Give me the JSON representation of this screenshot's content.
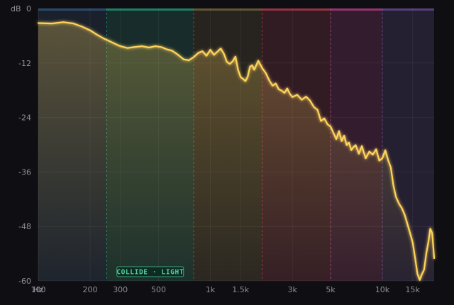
{
  "chart_data": {
    "type": "area",
    "xscale": "log",
    "xlim": [
      100,
      20000
    ],
    "ylim": [
      -60,
      0
    ],
    "ylabel": "dB",
    "grid": true,
    "y_ticks": [
      0,
      -12,
      -24,
      -36,
      -48,
      -60
    ],
    "x_ticks": [
      {
        "value": 100,
        "label": "100"
      },
      {
        "value": 100,
        "label": "Hz"
      },
      {
        "value": 200,
        "label": "200"
      },
      {
        "value": 300,
        "label": "300"
      },
      {
        "value": 500,
        "label": "500"
      },
      {
        "value": 1000,
        "label": "1k"
      },
      {
        "value": 1500,
        "label": "1.5k"
      },
      {
        "value": 3000,
        "label": "3k"
      },
      {
        "value": 5000,
        "label": "5k"
      },
      {
        "value": 10000,
        "label": "10k"
      },
      {
        "value": 15000,
        "label": "15k"
      }
    ],
    "bands": [
      {
        "from": 100,
        "to": 250,
        "color": "#2e5a86"
      },
      {
        "from": 250,
        "to": 800,
        "color": "#1fa37a"
      },
      {
        "from": 800,
        "to": 2000,
        "color": "#7a6a38"
      },
      {
        "from": 2000,
        "to": 5000,
        "color": "#c0374f"
      },
      {
        "from": 5000,
        "to": 10000,
        "color": "#c23a8a"
      },
      {
        "from": 10000,
        "to": 20000,
        "color": "#6a4aa0"
      }
    ],
    "line_color": "#ffd45c",
    "series": [
      {
        "x": [
          100,
          120,
          140,
          160,
          180,
          200,
          220,
          240,
          260,
          280,
          300,
          330,
          360,
          400,
          440,
          480,
          520,
          560,
          600,
          650,
          700,
          750,
          800,
          850,
          900,
          950,
          1000,
          1050,
          1100,
          1150,
          1200,
          1250,
          1300,
          1350,
          1400,
          1450,
          1500,
          1550,
          1600,
          1650,
          1700,
          1750,
          1800,
          1900,
          2000,
          2100,
          2200,
          2300,
          2400,
          2500,
          2600,
          2700,
          2800,
          2900,
          3000,
          3200,
          3400,
          3600,
          3800,
          4000,
          4200,
          4400,
          4600,
          4800,
          5000,
          5200,
          5400,
          5600,
          5800,
          6000,
          6200,
          6400,
          6600,
          6800,
          7000,
          7300,
          7600,
          8000,
          8400,
          8800,
          9200,
          9600,
          10000,
          10400,
          10800,
          11200,
          11600,
          12000,
          12500,
          13000,
          13500,
          14000,
          14500,
          15000,
          15500,
          16000,
          16500,
          17000,
          17500,
          18000,
          18500,
          19000,
          19500,
          20000
        ],
        "y": [
          -3.2,
          -3.3,
          -3.0,
          -3.3,
          -4.0,
          -4.8,
          -5.8,
          -6.6,
          -7.2,
          -7.8,
          -8.3,
          -8.7,
          -8.5,
          -8.3,
          -8.6,
          -8.3,
          -8.5,
          -9.0,
          -9.3,
          -10.2,
          -11.2,
          -11.4,
          -10.7,
          -9.8,
          -9.4,
          -10.4,
          -9.1,
          -10.2,
          -9.5,
          -8.8,
          -10.0,
          -11.8,
          -12.2,
          -11.6,
          -10.6,
          -13.5,
          -15.1,
          -15.5,
          -16.0,
          -15.0,
          -12.8,
          -12.5,
          -13.5,
          -11.5,
          -13.1,
          -14.2,
          -15.8,
          -17.0,
          -16.5,
          -17.8,
          -18.1,
          -18.6,
          -17.6,
          -18.8,
          -19.5,
          -19.0,
          -20.1,
          -19.4,
          -20.3,
          -21.7,
          -22.3,
          -24.8,
          -24.2,
          -25.5,
          -26.0,
          -27.4,
          -28.8,
          -27.0,
          -29.2,
          -28.0,
          -30.1,
          -29.5,
          -31.2,
          -30.5,
          -30.1,
          -32.0,
          -30.3,
          -33.0,
          -31.5,
          -32.2,
          -31.0,
          -33.5,
          -33.0,
          -31.2,
          -33.4,
          -35.0,
          -39.0,
          -41.5,
          -43.0,
          -44.0,
          -45.5,
          -47.5,
          -49.5,
          -51.5,
          -55.0,
          -58.5,
          -59.8,
          -58.5,
          -57.5,
          -54.0,
          -51.5,
          -48.5,
          -49.5,
          -55.0
        ]
      }
    ]
  },
  "badge": {
    "label": "COLLIDE · LIGHT",
    "color": "#4fd6a0",
    "background": "#0e2a22",
    "band_from": 250,
    "band_to": 800
  }
}
